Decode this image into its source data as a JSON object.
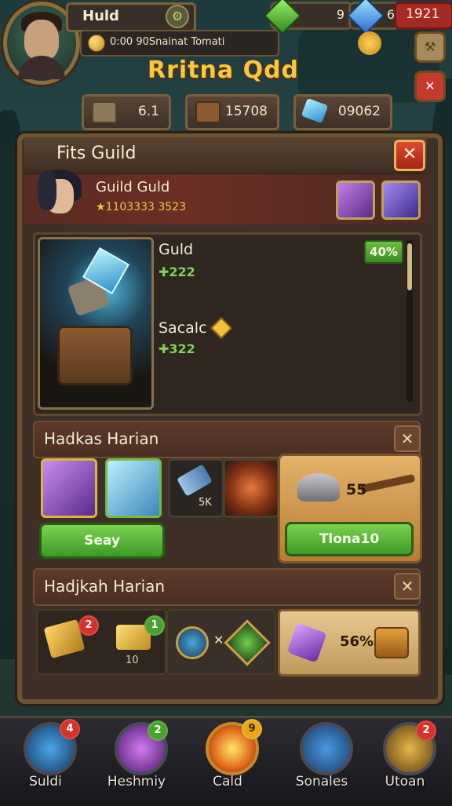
{
  "player": {
    "name": "Huld",
    "status_text": "0:00 90Snainat Tomati"
  },
  "currencies": {
    "green_value": "9",
    "blue_value": "6",
    "red_value": "1921"
  },
  "screen_title": "Rritna Qdd",
  "resources": [
    {
      "icon": "crate-icon",
      "value": "6.1"
    },
    {
      "icon": "chest-icon",
      "value": "15708"
    },
    {
      "icon": "crystal-icon",
      "value": "09062"
    }
  ],
  "panel": {
    "title": "Fits Guild",
    "guild_name": "Guild  Guld",
    "guild_stars": "★1103333 3523"
  },
  "featured": {
    "item1_name": "Guld",
    "item1_value": "✚222",
    "item2_name": "Sacalc",
    "item2_value": "✚322",
    "badge": "40%"
  },
  "section1": {
    "title": "Hadkas Harian",
    "slot3_label": "5K",
    "button_label": "Seay",
    "offer_value": "55",
    "offer_button": "Tlona10"
  },
  "section2": {
    "title": "Hadjkah Harian",
    "badge1": "2",
    "badge2": "1",
    "slot_count": "10",
    "offer_value": "56%"
  },
  "nav": [
    {
      "label": "Suldi",
      "badge": "4",
      "icon": "crystal-icon"
    },
    {
      "label": "Heshmiy",
      "badge": "2",
      "icon": "gem-box-icon"
    },
    {
      "label": "Cald",
      "badge": "9",
      "icon": "lightning-icon"
    },
    {
      "label": "Sonales",
      "badge": "",
      "icon": "shield-icon"
    },
    {
      "label": "Utoan",
      "badge": "2",
      "icon": "lock-icon"
    }
  ]
}
